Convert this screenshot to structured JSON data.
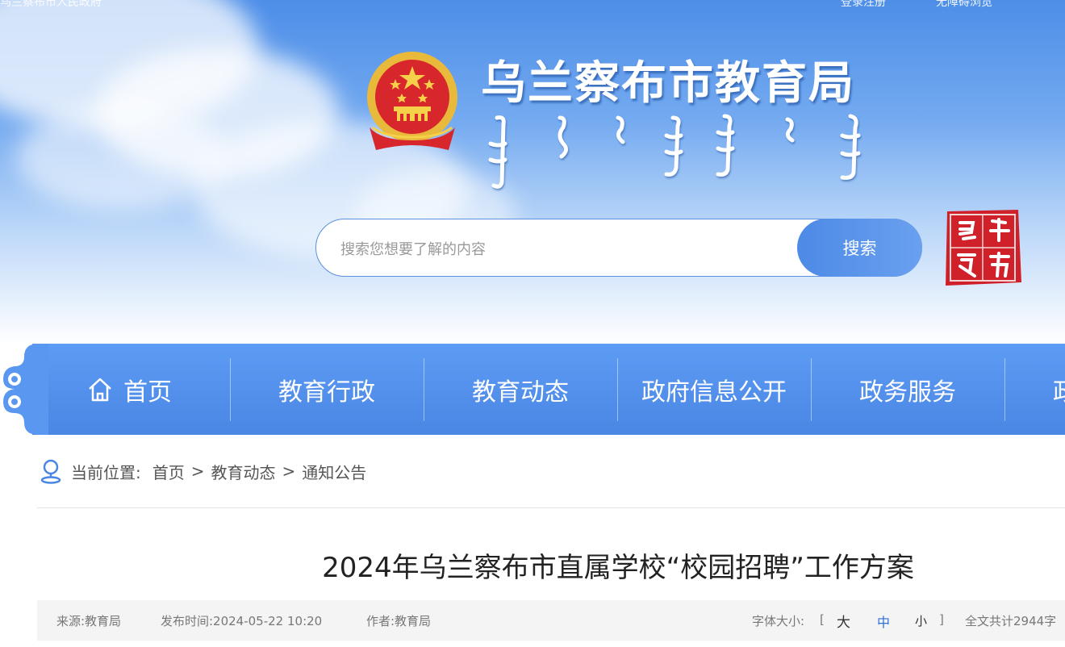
{
  "top_bar": {
    "left_text": "乌兰察布市人民政府",
    "right_items": [
      "登录注册",
      "无障碍浏览"
    ]
  },
  "header": {
    "site_title": "乌兰察布市教育局",
    "emblem_icon": "national-emblem-icon",
    "seal_text": "乌兰察布"
  },
  "search": {
    "placeholder": "搜索您想要了解的内容",
    "button_label": "搜索"
  },
  "nav": {
    "items": [
      {
        "label": "首页",
        "icon": "home-icon"
      },
      {
        "label": "教育行政"
      },
      {
        "label": "教育动态"
      },
      {
        "label": "政府信息公开"
      },
      {
        "label": "政务服务"
      },
      {
        "label": "政"
      }
    ]
  },
  "breadcrumb": {
    "prefix": "当前位置:",
    "items": [
      "首页",
      "教育动态",
      "通知公告"
    ],
    "separator": ">"
  },
  "article": {
    "title": "2024年乌兰察布市直属学校“校园招聘”工作方案",
    "source": "来源:教育局",
    "publish_time": "发布时间:2024-05-22 10:20",
    "author": "作者:教育局",
    "font_size_label": "字体大小:",
    "bracket_open": "[",
    "bracket_close": "]",
    "font_sizes": [
      "大",
      "中",
      "小"
    ],
    "word_count": "全文共计2944字"
  },
  "colors": {
    "nav_blue": "#4a86e4",
    "accent_blue": "#2f6fd4",
    "seal_red": "#d0202a"
  }
}
